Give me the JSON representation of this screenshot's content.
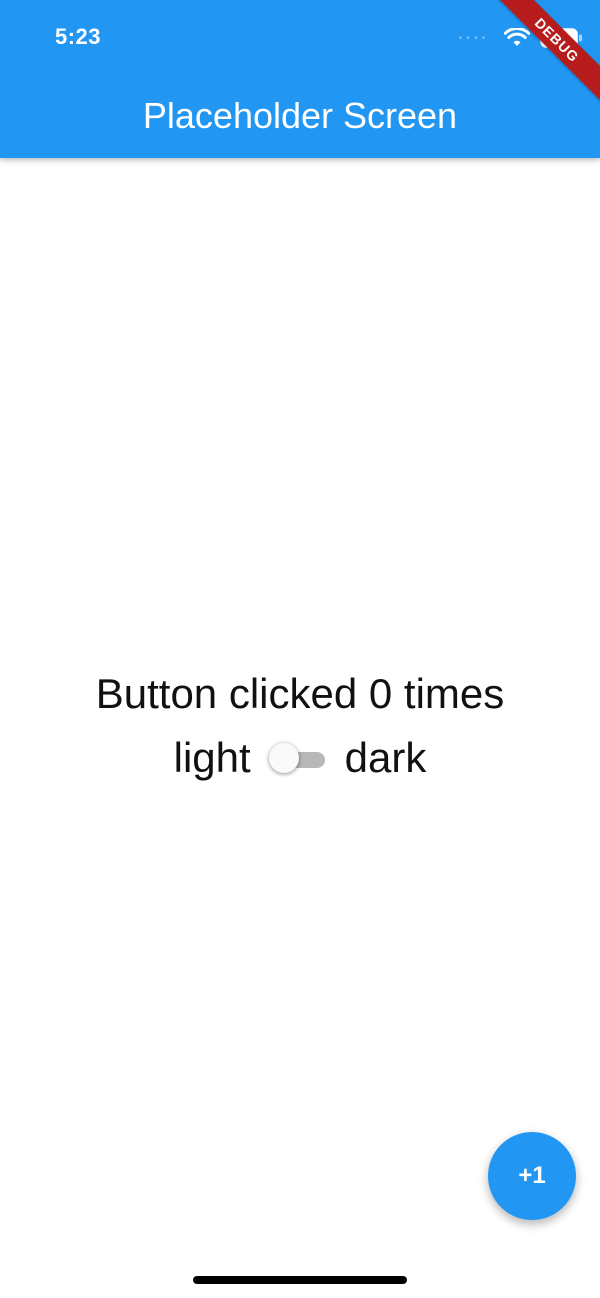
{
  "status_bar": {
    "time": "5:23",
    "signal_text": "• • • • ",
    "wifi_icon": "wifi-icon",
    "battery_icon": "battery-icon"
  },
  "app_bar": {
    "title": "Placeholder Screen",
    "color": "#2196F3"
  },
  "debug_banner": {
    "label": "DEBUG",
    "color": "#b71c1c"
  },
  "main": {
    "counter_text": "Button clicked 0 times",
    "toggle_left_label": "light",
    "toggle_right_label": "dark",
    "toggle_on": false
  },
  "fab": {
    "label": "+1",
    "color": "#2196F3"
  }
}
